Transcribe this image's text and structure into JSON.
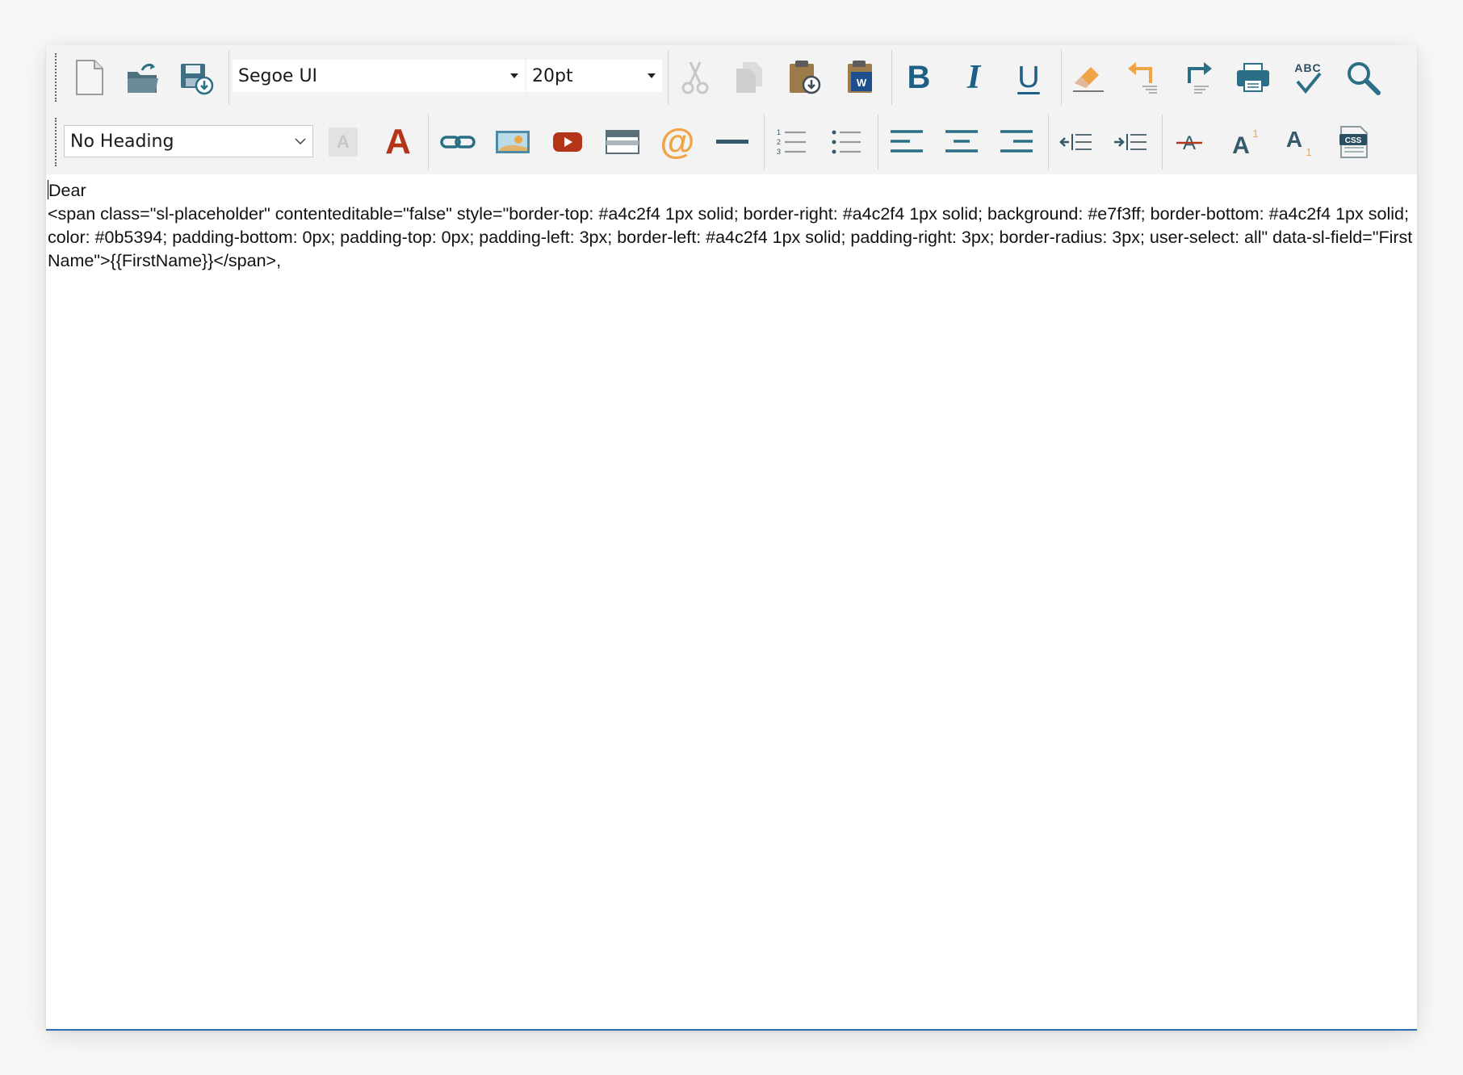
{
  "toolbar_row1": {
    "font_family_value": "Segoe UI",
    "font_size_value": "20pt",
    "buttons": [
      {
        "name": "new-document-button",
        "icon": "new-document-icon"
      },
      {
        "name": "open-button",
        "icon": "open-folder-icon"
      },
      {
        "name": "save-button",
        "icon": "save-icon"
      },
      {
        "name": "cut-button",
        "icon": "scissors-icon",
        "disabled": true
      },
      {
        "name": "copy-button",
        "icon": "copy-icon",
        "disabled": true
      },
      {
        "name": "paste-button",
        "icon": "clipboard-icon"
      },
      {
        "name": "paste-from-word-button",
        "icon": "word-icon"
      },
      {
        "name": "bold-button",
        "icon": "bold-icon",
        "glyph": "B"
      },
      {
        "name": "italic-button",
        "icon": "italic-icon",
        "glyph": "I"
      },
      {
        "name": "underline-button",
        "icon": "underline-icon",
        "glyph": "U"
      },
      {
        "name": "eraser-button",
        "icon": "eraser-icon"
      },
      {
        "name": "undo-button",
        "icon": "undo-icon"
      },
      {
        "name": "redo-button",
        "icon": "redo-icon"
      },
      {
        "name": "print-button",
        "icon": "printer-icon"
      },
      {
        "name": "spellcheck-button",
        "icon": "spellcheck-icon",
        "glyph": "ABC"
      },
      {
        "name": "find-button",
        "icon": "search-icon"
      }
    ]
  },
  "toolbar_row2": {
    "heading_value": "No Heading",
    "buttons": [
      {
        "name": "highlight-color-button",
        "icon": "highlight-icon",
        "glyph": "A",
        "disabled": true
      },
      {
        "name": "font-color-button",
        "icon": "font-color-icon",
        "glyph": "A"
      },
      {
        "name": "insert-link-button",
        "icon": "link-icon"
      },
      {
        "name": "insert-image-button",
        "icon": "image-icon"
      },
      {
        "name": "insert-video-button",
        "icon": "video-icon"
      },
      {
        "name": "insert-table-button",
        "icon": "table-icon"
      },
      {
        "name": "insert-email-button",
        "icon": "at-sign-icon",
        "glyph": "@"
      },
      {
        "name": "horizontal-rule-button",
        "icon": "horizontal-line-icon"
      },
      {
        "name": "numbered-list-button",
        "icon": "numbered-list-icon"
      },
      {
        "name": "bullet-list-button",
        "icon": "bullet-list-icon"
      },
      {
        "name": "align-left-button",
        "icon": "align-left-icon"
      },
      {
        "name": "align-center-button",
        "icon": "align-center-icon"
      },
      {
        "name": "align-right-button",
        "icon": "align-right-icon"
      },
      {
        "name": "outdent-button",
        "icon": "outdent-icon"
      },
      {
        "name": "indent-button",
        "icon": "indent-icon"
      },
      {
        "name": "strikethrough-button",
        "icon": "strikethrough-icon",
        "glyph": "A"
      },
      {
        "name": "superscript-button",
        "icon": "superscript-icon",
        "glyph": "A",
        "sub": "1"
      },
      {
        "name": "subscript-button",
        "icon": "subscript-icon",
        "glyph": "A",
        "sub": "1"
      },
      {
        "name": "css-button",
        "icon": "css-icon",
        "glyph": "CSS"
      }
    ]
  },
  "document": {
    "line1": "Dear",
    "line2": "<span class=\"sl-placeholder\" contenteditable=\"false\" style=\"border-top: #a4c2f4 1px solid; border-right: #a4c2f4 1px solid; background: #e7f3ff; border-bottom: #a4c2f4 1px solid; color: #0b5394; padding-bottom: 0px; padding-top: 0px; padding-left: 3px; border-left: #a4c2f4 1px solid; padding-right: 3px; border-radius: 3px; user-select: all\" data-sl-field=\"First Name\">{{FirstName}}</span>,"
  },
  "colors": {
    "icon_blue": "#2a6f86",
    "icon_dark": "#345a6c",
    "icon_orange": "#f0a448",
    "icon_red": "#b4341a",
    "accent_border": "#2e6db4"
  }
}
